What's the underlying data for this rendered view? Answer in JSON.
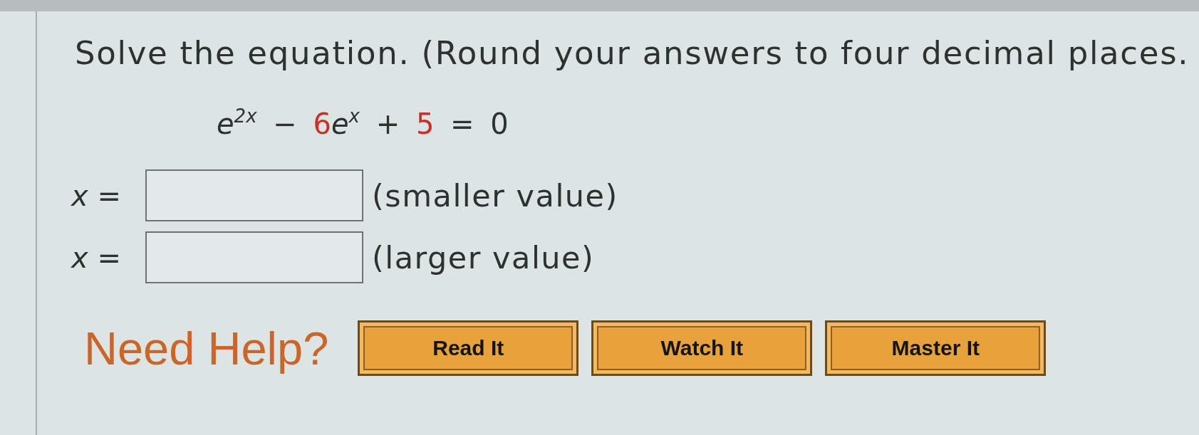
{
  "question": {
    "text": "Solve the equation. (Round your answers to four decimal places."
  },
  "equation": [
    {
      "kind": "term",
      "text": "*e*$^{2x}$ − "
    },
    {
      "kind": "coefficient",
      "text": "6"
    },
    {
      "kind": "term",
      "text": "*e*$^{x}$ + "
    },
    {
      "kind": "coefficient",
      "text": "5"
    },
    {
      "kind": "term",
      "text": " = 0"
    }
  ],
  "answers": [
    {
      "label": "*x* =",
      "hint": "(smaller value)"
    },
    {
      "label": "*x* =",
      "hint": "(larger value)"
    }
  ],
  "help": {
    "label": "Need Help?",
    "buttons": [
      "Read It",
      "Watch It",
      "Master It"
    ]
  }
}
